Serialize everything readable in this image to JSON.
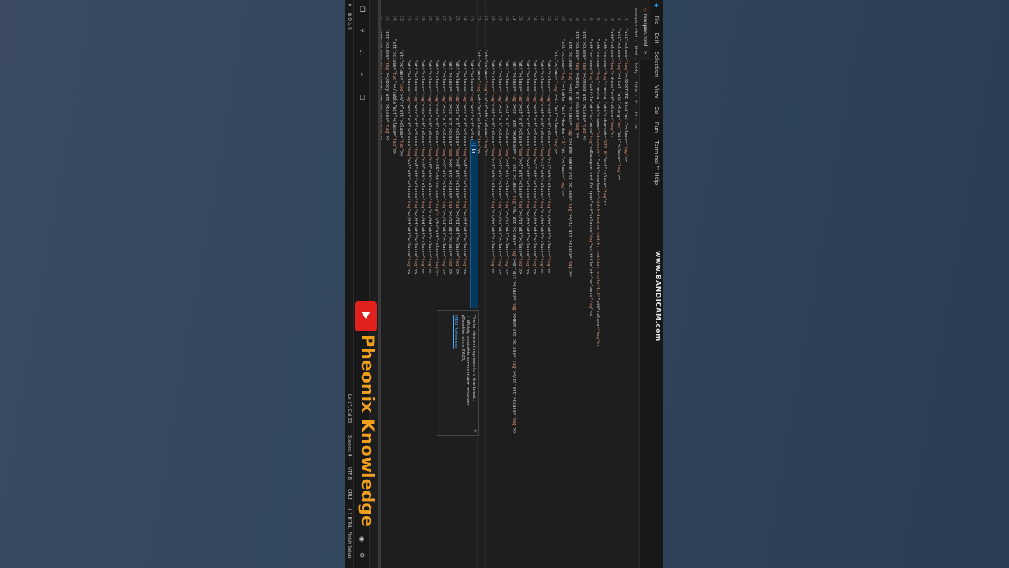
{
  "menubar": {
    "items": [
      "File",
      "Edit",
      "Selection",
      "View",
      "Go",
      "Run",
      "Terminal",
      "Help"
    ]
  },
  "watermark": "www.BANDICAM.com",
  "tab": {
    "label": "rowspan.html",
    "close": "×"
  },
  "breadcrumbs": [
    "rowspan.html",
    "html",
    "body",
    "table",
    "tr",
    "th",
    "br"
  ],
  "editor": {
    "lines": [
      {
        "n": "1",
        "code": "<!DOCTYPE html>"
      },
      {
        "n": "2",
        "code": "<html lang=\"en\">"
      },
      {
        "n": "3",
        "code": "<head>"
      },
      {
        "n": "4",
        "code": "    <meta charset=\"UTF-8\">"
      },
      {
        "n": "5",
        "code": "    <meta name=\"viewport\" content=\"width=device-width, initial-scale=1.0\">"
      },
      {
        "n": "6",
        "code": "    <title>Rowspan and Colspan</title>"
      },
      {
        "n": "7",
        "code": "</head>"
      },
      {
        "n": "8",
        "code": "<body>"
      },
      {
        "n": "9",
        "code": "    <h2>Time Table</h2>"
      },
      {
        "n": "10",
        "code": "    <table border=\"1\">"
      },
      {
        "n": "11",
        "code": "        <tr>"
      },
      {
        "n": "12",
        "code": "            <th>1</th>"
      },
      {
        "n": "13",
        "code": "            <th>2</th>"
      },
      {
        "n": "14",
        "code": "            <th>3</th>"
      },
      {
        "n": "15",
        "code": "            <th>4</th>"
      },
      {
        "n": "16",
        "code": "            <th>5</th>"
      },
      {
        "n": "17",
        "code": "            <th ROWspan=\"2\">L<br>NCH</th>"
      },
      {
        "n": "18",
        "code": "            <th>6</th>"
      },
      {
        "n": "19",
        "code": "            <th>7</th>"
      },
      {
        "n": "20",
        "code": "            <th>8</th>"
      },
      {
        "n": "21",
        "code": "        </tr>"
      },
      {
        "n": "22",
        "code": "        <tr>"
      },
      {
        "n": "23",
        "code": "            <td>Monday</td>"
      },
      {
        "n": "24",
        "code": "            <td>E</td>"
      },
      {
        "n": "25",
        "code": "            <td>E</td>"
      },
      {
        "n": "26",
        "code": "            <td>M</td>"
      },
      {
        "n": "27",
        "code": "            <td>S</td>"
      },
      {
        "n": "28",
        "code": "            <td>SS</td>"
      },
      {
        "n": "29",
        "code": "            <td>M</td>"
      },
      {
        "n": "30",
        "code": "            <td>H</td>"
      },
      {
        "n": "31",
        "code": "            <td>E</td>"
      },
      {
        "n": "32",
        "code": "            <td>S</td>"
      },
      {
        "n": "33",
        "code": "        </tr>"
      },
      {
        "n": "34",
        "code": "    </table>"
      },
      {
        "n": "35",
        "code": "</body>"
      },
      {
        "n": "36",
        "code": "</html>"
      }
    ],
    "current_line": "17"
  },
  "suggestion": {
    "label": "br"
  },
  "doc_popup": {
    "line1": "The br element represents a line break.",
    "line2": "Widely available across major browsers",
    "line3": "(Baseline since 2015)",
    "link": "MDN Reference",
    "close": "×"
  },
  "statusbar": {
    "position": "Ln 17, Col 33",
    "spaces": "Spaces: 4",
    "encoding": "UTF-8",
    "eol": "CRLF",
    "language": "{ } HTML",
    "finish_setup": "Finish Setup",
    "errors": "0",
    "warnings": "0"
  },
  "branding": {
    "text": "Pheonix Knowledge"
  }
}
